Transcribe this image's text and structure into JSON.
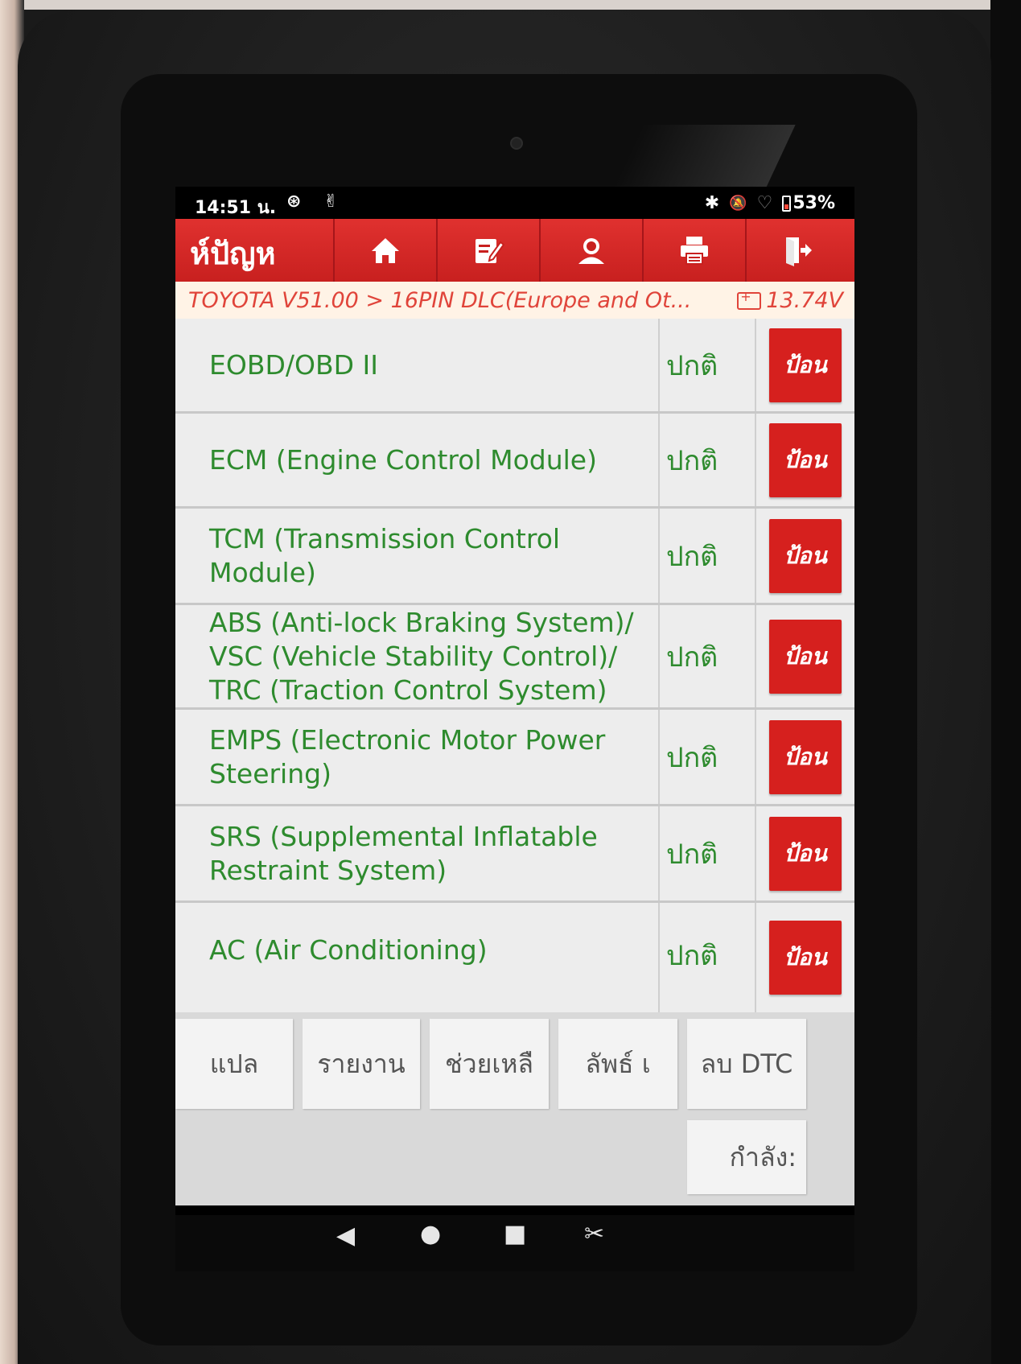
{
  "statusbar": {
    "time": "14:51 น.",
    "left_icons": "⊛ ✌",
    "bluetooth": "✱",
    "mute": "🔕",
    "wifi": "♡",
    "battery": "53%"
  },
  "toolbar": {
    "title": "ห์ปัญห",
    "buttons": [
      "home-icon",
      "edit-icon",
      "user-icon",
      "print-icon",
      "exit-icon"
    ]
  },
  "breadcrumb": {
    "path": "TOYOTA V51.00 > 16PIN DLC(Europe and Ot...",
    "voltage": "13.74V"
  },
  "modules": [
    {
      "name": "EOBD/OBD II",
      "status": "ปกติ",
      "button": "ป้อน"
    },
    {
      "name": "ECM (Engine Control Module)",
      "status": "ปกติ",
      "button": "ป้อน"
    },
    {
      "name": "TCM (Transmission Control Module)",
      "status": "ปกติ",
      "button": "ป้อน"
    },
    {
      "name": "ABS (Anti-lock Braking System)/ VSC (Vehicle Stability Control)/ TRC (Traction Control System)",
      "status": "ปกติ",
      "button": "ป้อน"
    },
    {
      "name": "EMPS (Electronic Motor Power Steering)",
      "status": "ปกติ",
      "button": "ป้อน"
    },
    {
      "name": "SRS (Supplemental Inflatable Restraint System)",
      "status": "ปกติ",
      "button": "ป้อน"
    },
    {
      "name": "AC (Air Conditioning)",
      "status": "ปกติ",
      "button": "ป้อน"
    }
  ],
  "functions": {
    "translate": "แปล",
    "report": "รายงาน",
    "help": "ช่วยเหลื",
    "result": "ลัพธ์ เ",
    "clear_dtc": "ลบ DTC",
    "processing": "กำลัง:"
  },
  "colors": {
    "toolbar_red": "#d6201e",
    "text_green": "#2e8b2e",
    "breadcrumb_text": "#e0443a"
  }
}
